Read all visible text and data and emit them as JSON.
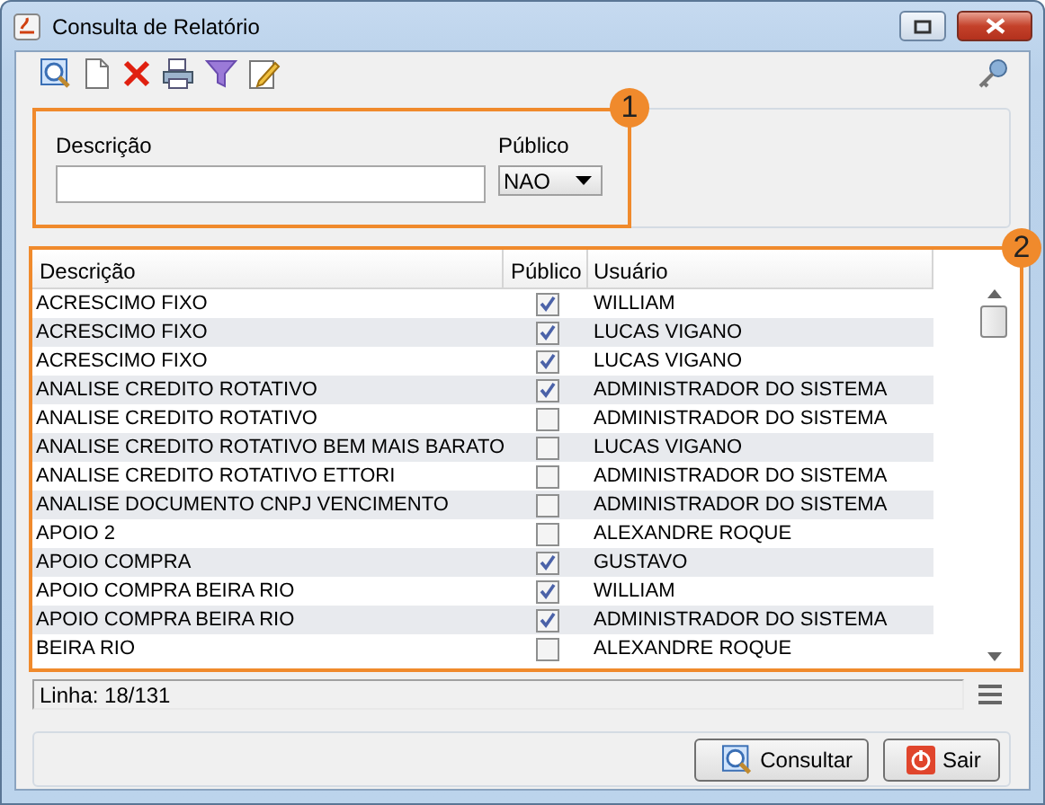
{
  "window": {
    "title": "Consulta de Relatório"
  },
  "filter": {
    "callout": "1",
    "description_field": {
      "label": "Descrição"
    },
    "public_field": {
      "label": "Público",
      "value": "NAO"
    }
  },
  "table": {
    "callout": "2",
    "columns": [
      "Descrição",
      "Público",
      "Usuário"
    ],
    "rows": [
      {
        "description": "ACRESCIMO FIXO",
        "public": true,
        "user": "WILLIAM"
      },
      {
        "description": "ACRESCIMO FIXO",
        "public": true,
        "user": "LUCAS VIGANO"
      },
      {
        "description": "ACRESCIMO FIXO",
        "public": true,
        "user": "LUCAS VIGANO"
      },
      {
        "description": "ANALISE CREDITO ROTATIVO",
        "public": true,
        "user": "ADMINISTRADOR DO SISTEMA"
      },
      {
        "description": "ANALISE CREDITO ROTATIVO",
        "public": false,
        "user": "ADMINISTRADOR DO SISTEMA"
      },
      {
        "description": "ANALISE CREDITO ROTATIVO BEM MAIS BARATO",
        "public": false,
        "user": "LUCAS VIGANO"
      },
      {
        "description": "ANALISE CREDITO ROTATIVO ETTORI",
        "public": false,
        "user": "ADMINISTRADOR DO SISTEMA"
      },
      {
        "description": "ANALISE DOCUMENTO CNPJ VENCIMENTO",
        "public": false,
        "user": "ADMINISTRADOR DO SISTEMA"
      },
      {
        "description": "APOIO 2",
        "public": false,
        "user": "ALEXANDRE ROQUE"
      },
      {
        "description": "APOIO COMPRA",
        "public": true,
        "user": "GUSTAVO"
      },
      {
        "description": "APOIO COMPRA BEIRA RIO",
        "public": true,
        "user": "WILLIAM"
      },
      {
        "description": "APOIO COMPRA BEIRA RIO",
        "public": true,
        "user": "ADMINISTRADOR DO SISTEMA"
      },
      {
        "description": "BEIRA RIO",
        "public": false,
        "user": "ALEXANDRE ROQUE"
      }
    ]
  },
  "status_bar": "Linha: 18/131",
  "buttons": [
    {
      "label": "Consultar",
      "kind": "search"
    },
    {
      "label": "Sair",
      "kind": "exit"
    }
  ]
}
